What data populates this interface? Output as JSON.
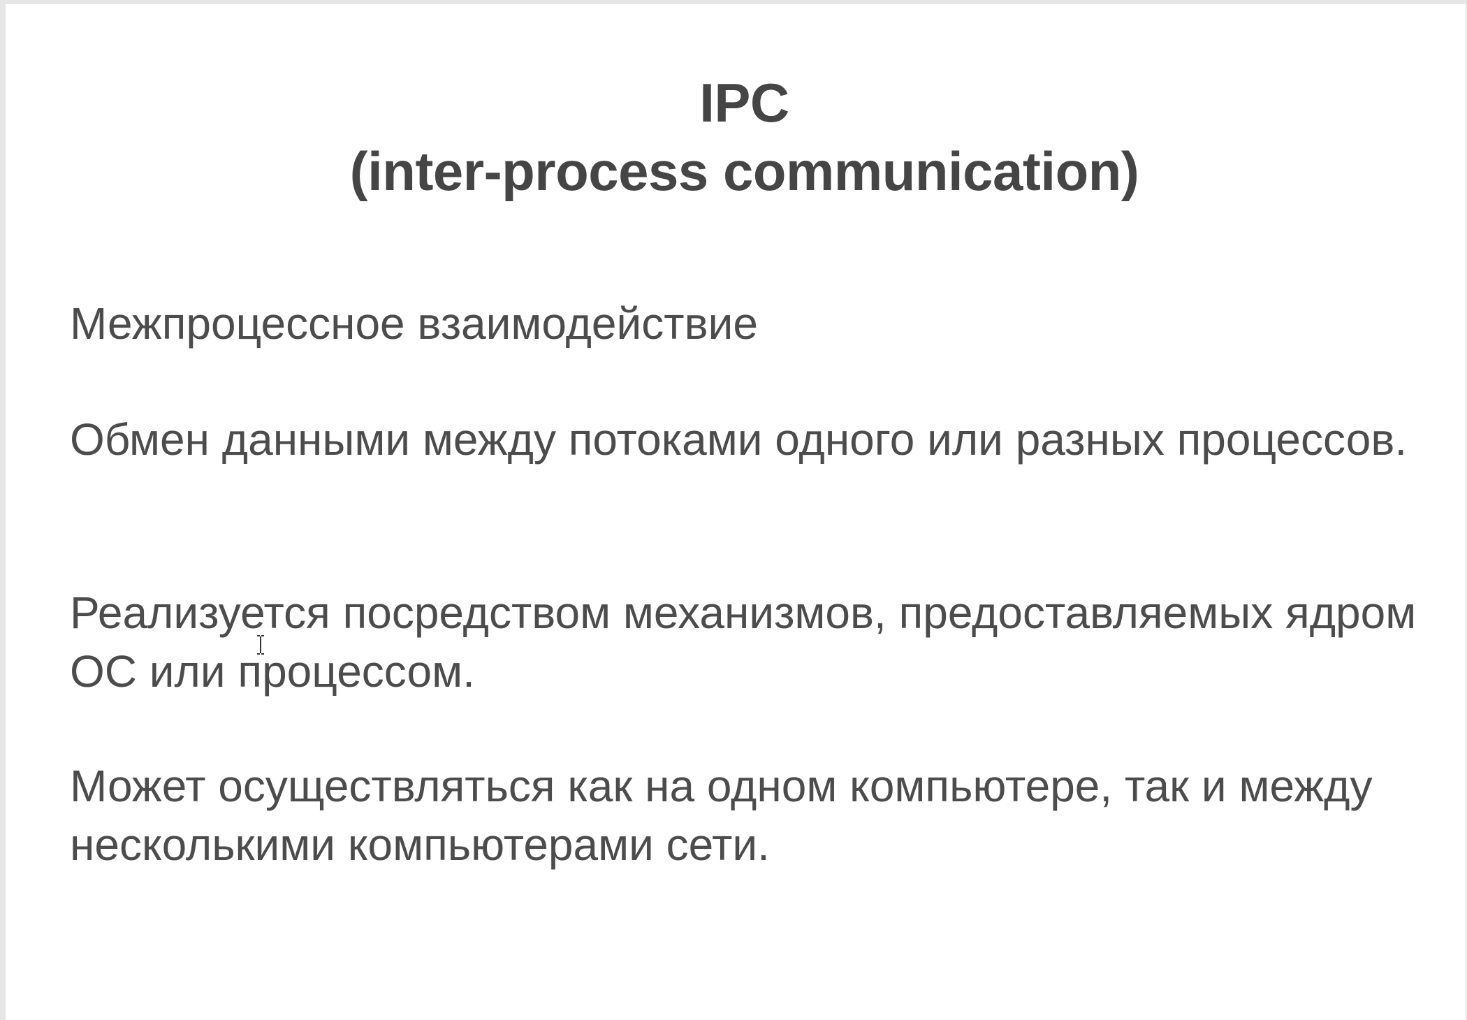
{
  "slide": {
    "title_line1": "IPC",
    "title_line2": "(inter-process communication)",
    "paragraphs": [
      "Межпроцессное взаимодействие",
      "Обмен данными между потоками одного или разных процессов.",
      "Реализуется посредством механизмов, предоставляемых ядром ОС или процессом.",
      "Может осуществляться как на одном компьютере, так и между несколькими компьютерами сети."
    ]
  },
  "cursor": {
    "icon": "text-cursor-icon"
  }
}
